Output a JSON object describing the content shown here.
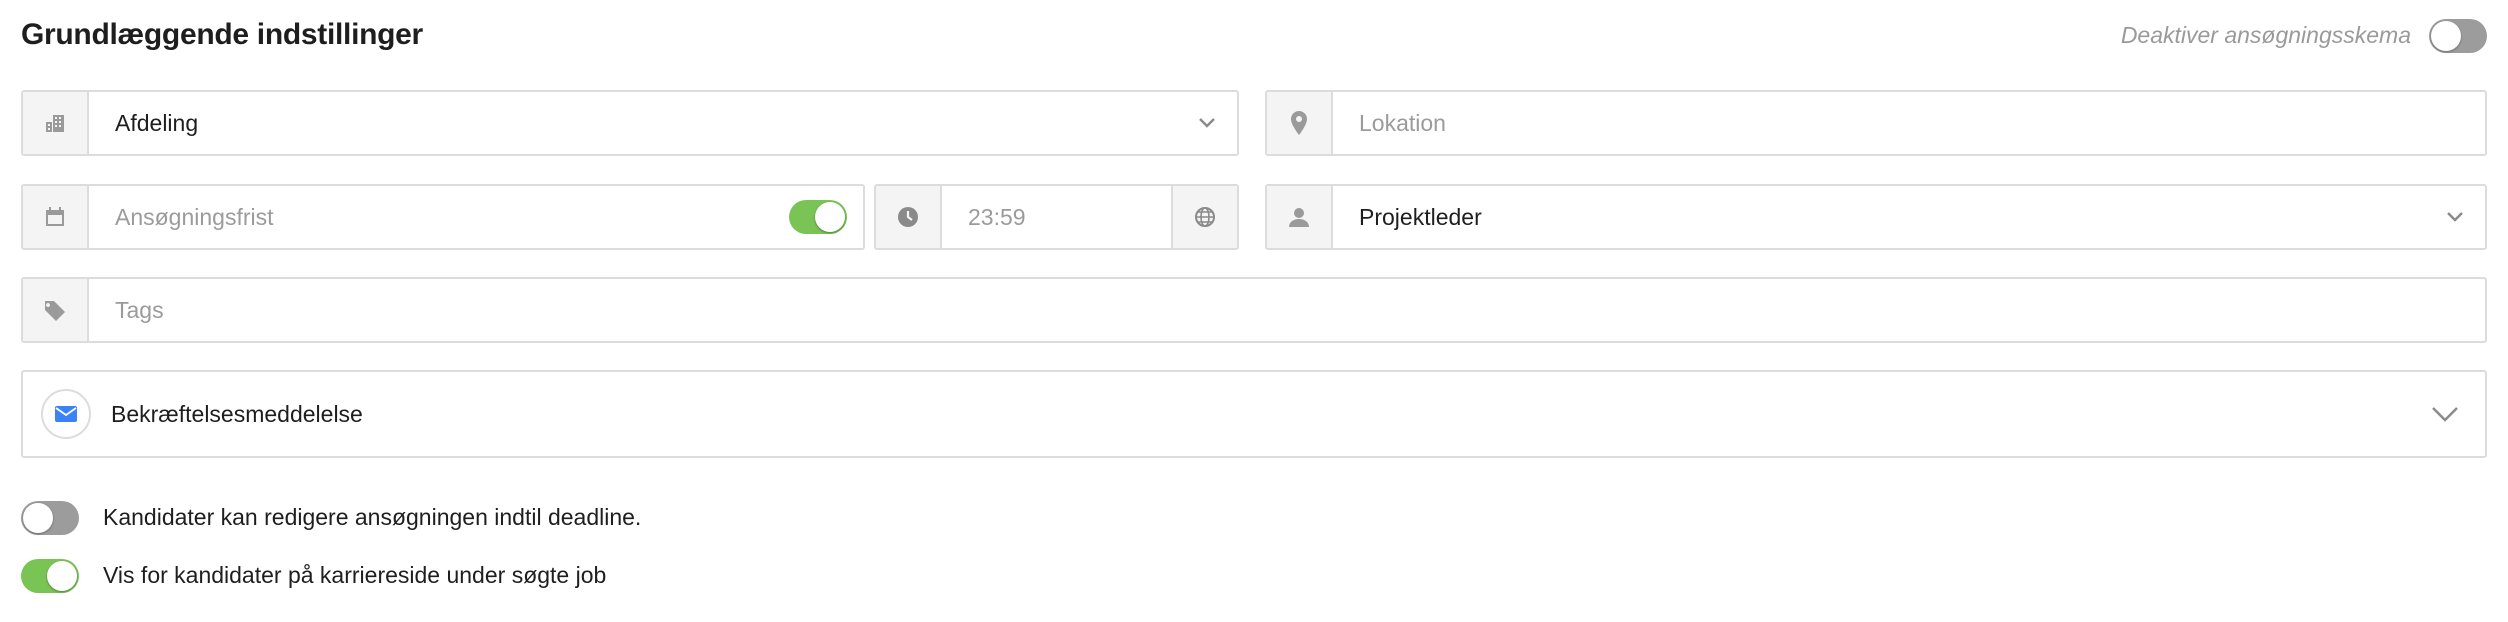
{
  "header": {
    "title": "Grundlæggende indstillinger",
    "deactivate_label": "Deaktiver ansøgningsskema",
    "deactivate_on": false
  },
  "fields": {
    "department": {
      "value": "Afdeling",
      "icon": "building-icon"
    },
    "location": {
      "placeholder": "Lokation",
      "icon": "map-pin-icon"
    },
    "deadline": {
      "placeholder": "Ansøgningsfrist",
      "icon": "calendar-icon",
      "toggle_on": true
    },
    "time": {
      "value": "23:59",
      "icon": "clock-icon",
      "suffix_icon": "globe-icon"
    },
    "role": {
      "value": "Projektleder",
      "icon": "user-icon"
    },
    "tags": {
      "placeholder": "Tags",
      "icon": "tag-icon"
    }
  },
  "confirmation": {
    "label": "Bekræftelsesmeddelelse",
    "icon": "envelope-icon"
  },
  "options": [
    {
      "label": "Kandidater kan redigere ansøgningen indtil deadline.",
      "on": false
    },
    {
      "label": "Vis for kandidater på karriereside under søgte job",
      "on": true
    }
  ],
  "colors": {
    "accent_green": "#7ac355",
    "email_blue": "#3b82f6"
  }
}
